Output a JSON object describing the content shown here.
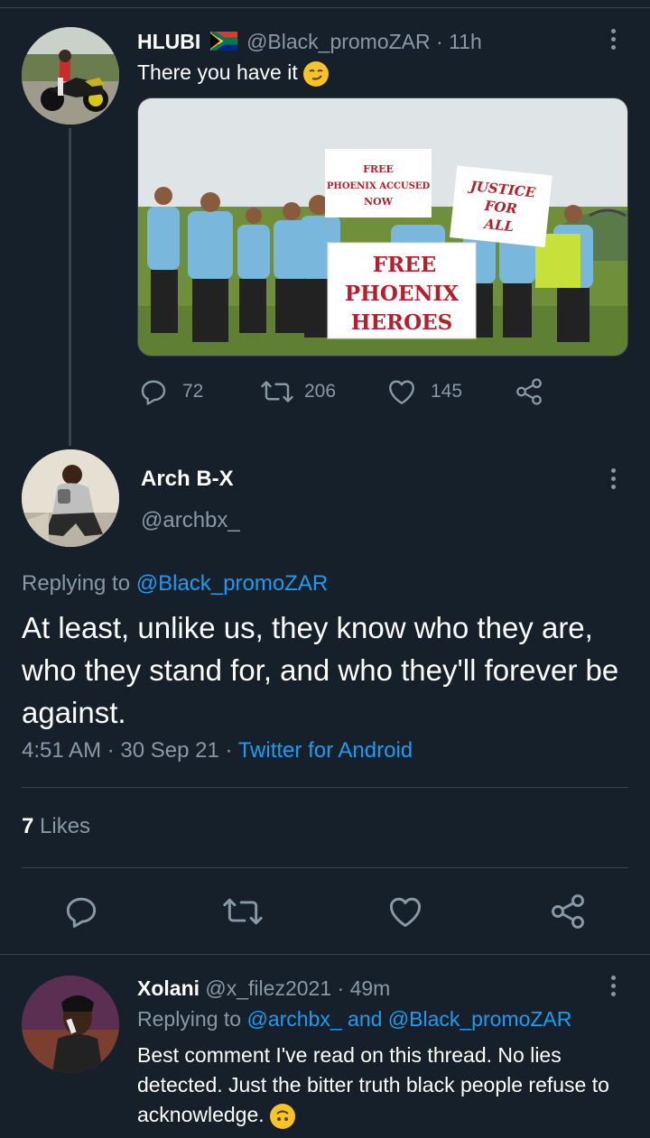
{
  "tweet1": {
    "display_name": "HLUBI",
    "handle": "@Black_promoZAR",
    "time": "· 11h",
    "text": "There you have it",
    "photo_signs": {
      "sign1": [
        "FREE",
        "PHOENIX ACCUSED",
        "NOW"
      ],
      "sign2": [
        "JUSTICE",
        "FOR",
        "ALL"
      ],
      "sign3": [
        "FREE",
        "PHOENIX",
        "HEROES"
      ]
    },
    "reply_count": "72",
    "retweet_count": "206",
    "like_count": "145"
  },
  "tweet2": {
    "display_name": "Arch B-X",
    "handle": "@archbx_",
    "replying_label": "Replying to",
    "replying_to": "@Black_promoZAR",
    "text": "At least, unlike us, they know who they are, who they stand for, and who they'll forever be against.",
    "time": "4:51 AM",
    "date": "· 30 Sep 21 ·",
    "source": "Twitter for Android",
    "likes_count": "7",
    "likes_label": "Likes"
  },
  "tweet3": {
    "display_name": "Xolani",
    "handle": "@x_filez2021",
    "time": "· 49m",
    "replying_label": "Replying to",
    "replying_to": "@archbx_ and @Black_promoZAR",
    "text": "Best comment I've read on this thread. No lies detected. Just the bitter truth black people refuse to acknowledge."
  },
  "icons": [
    "flag-icon",
    "smirk-emoji-icon",
    "reply-icon",
    "retweet-icon",
    "like-icon",
    "share-icon",
    "more-icon",
    "upside-down-face-emoji-icon"
  ],
  "colors": {
    "background": "#15202b",
    "muted": "#8899a6",
    "link": "#1d9bf0",
    "divider": "#38444d"
  }
}
